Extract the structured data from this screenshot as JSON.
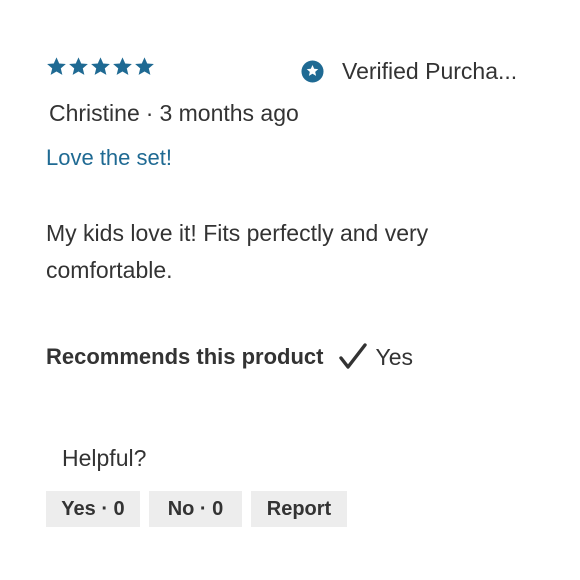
{
  "rating": {
    "stars": 5,
    "max_stars": 5,
    "color": "#1f6a93"
  },
  "verified": {
    "icon": "star-badge-icon",
    "label": "Verified Purcha..."
  },
  "author": {
    "name": "Christine",
    "separator": "·",
    "time": "3 months ago"
  },
  "review": {
    "title": "Love the set!",
    "body": "My kids love it! Fits perfectly and very comfortable."
  },
  "recommends": {
    "label": "Recommends this product",
    "icon": "checkmark-icon",
    "value": "Yes"
  },
  "helpful": {
    "label": "Helpful?",
    "yes_button": "Yes · 0",
    "no_button": "No · 0",
    "report_button": "Report"
  }
}
